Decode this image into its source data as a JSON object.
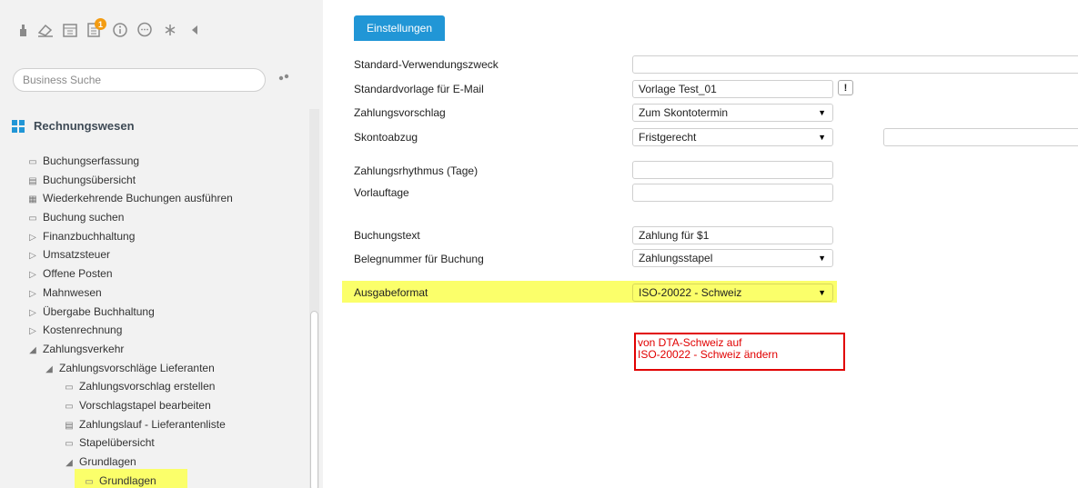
{
  "sidebar": {
    "toolbar_icons": [
      "thumb-icon",
      "eraser-icon",
      "calendar-icon",
      "tasks-icon",
      "info-icon",
      "chat-icon",
      "asterisk-icon",
      "collapse-icon"
    ],
    "badge_count": "1",
    "search": {
      "placeholder": "Business Suche",
      "value": ""
    },
    "section_title": "Rechnungswesen",
    "items": [
      {
        "label": "Buchungserfassung",
        "icon": "window-icon",
        "level": 0
      },
      {
        "label": "Buchungsübersicht",
        "icon": "print-icon",
        "level": 0
      },
      {
        "label": "Wiederkehrende Buchungen ausführen",
        "icon": "doc-icon",
        "level": 0
      },
      {
        "label": "Buchung suchen",
        "icon": "window-icon",
        "level": 0
      },
      {
        "label": "Finanzbuchhaltung",
        "icon": "expand-icon",
        "level": 0
      },
      {
        "label": "Umsatzsteuer",
        "icon": "expand-icon",
        "level": 0
      },
      {
        "label": "Offene Posten",
        "icon": "expand-icon",
        "level": 0
      },
      {
        "label": "Mahnwesen",
        "icon": "expand-icon",
        "level": 0
      },
      {
        "label": "Übergabe Buchhaltung",
        "icon": "expand-icon",
        "level": 0
      },
      {
        "label": "Kostenrechnung",
        "icon": "expand-icon",
        "level": 0
      },
      {
        "label": "Zahlungsverkehr",
        "icon": "collapse-triangle-icon",
        "level": 0
      },
      {
        "label": "Zahlungsvorschläge Lieferanten",
        "icon": "collapse-triangle-icon",
        "level": 1
      },
      {
        "label": "Zahlungsvorschlag erstellen",
        "icon": "window-icon",
        "level": 2
      },
      {
        "label": "Vorschlagstapel bearbeiten",
        "icon": "window-icon",
        "level": 2
      },
      {
        "label": "Zahlungslauf - Lieferantenliste",
        "icon": "print-icon",
        "level": 2
      },
      {
        "label": "Stapelübersicht",
        "icon": "window-icon",
        "level": 2
      },
      {
        "label": "Grundlagen",
        "icon": "collapse-triangle-icon",
        "level": 2
      },
      {
        "label": "Grundlagen",
        "icon": "window-icon",
        "level": 3
      }
    ]
  },
  "main": {
    "tab_label": "Einstellungen",
    "labels": {
      "verwendungszweck": "Standard-Verwendungszweck",
      "vorlage_email": "Standardvorlage für E-Mail",
      "zahlungsvorschlag": "Zahlungsvorschlag",
      "skontoabzug": "Skontoabzug",
      "rhythmus": "Zahlungsrhythmus (Tage)",
      "vorlauftage": "Vorlauftage",
      "buchungstext": "Buchungstext",
      "belegnummer": "Belegnummer für Buchung",
      "ausgabeformat": "Ausgabeformat"
    },
    "values": {
      "verwendungszweck": "",
      "vorlage_email": "Vorlage Test_01",
      "zahlungsvorschlag": "Zum Skontotermin",
      "skontoabzug": "Fristgerecht",
      "skonto_extra": "",
      "rhythmus": "",
      "vorlauftage": "",
      "buchungstext": "Zahlung für $1",
      "belegnummer": "Zahlungsstapel",
      "ausgabeformat": "ISO-20022 - Schweiz"
    },
    "info_button": "!",
    "annotation_line1": "von DTA-Schweiz auf",
    "annotation_line2": "ISO-20022 - Schweiz ändern"
  },
  "colors": {
    "accent": "#2196d6",
    "highlight": "#fbff6a",
    "annotation": "#e10000"
  }
}
